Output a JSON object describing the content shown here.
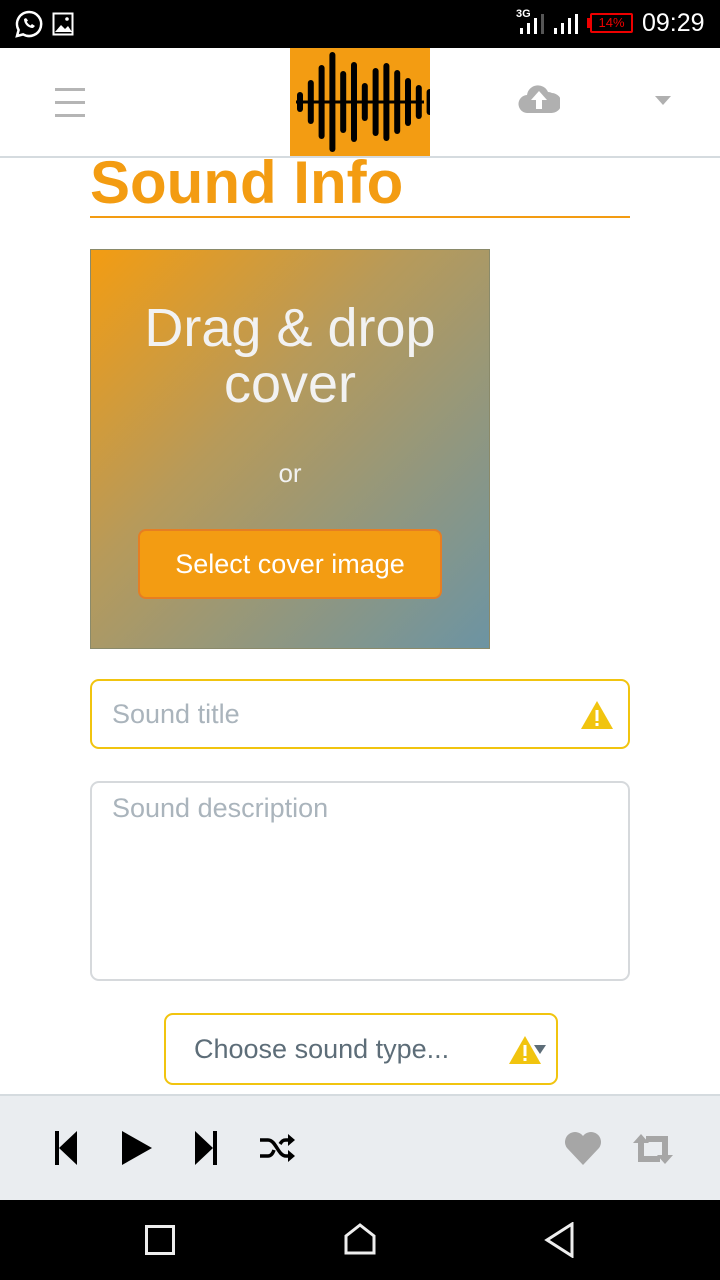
{
  "status_bar": {
    "battery": "14%",
    "time": "09:29",
    "network": "3G",
    "icons": [
      "whatsapp-icon",
      "image-icon",
      "signal-icon",
      "battery-icon"
    ]
  },
  "header": {
    "icons": [
      "menu-icon",
      "soundwave-logo",
      "cloud-upload-icon",
      "caret-down-icon"
    ]
  },
  "form": {
    "title": "Sound Info",
    "drop_zone": {
      "line1": "Drag & drop",
      "line2": "cover",
      "or": "or",
      "button": "Select cover image"
    },
    "sound_title_placeholder": "Sound title",
    "sound_description_placeholder": "Sound description",
    "sound_type_selected": "Choose sound type..."
  },
  "colors": {
    "accent": "#f39c12",
    "warning": "#f1c40f"
  },
  "player": {
    "icons": [
      "skip-back-icon",
      "play-icon",
      "skip-forward-icon",
      "shuffle-icon",
      "heart-icon",
      "repeat-icon"
    ]
  },
  "nav": {
    "icons": [
      "recents-icon",
      "home-icon",
      "back-icon"
    ]
  }
}
